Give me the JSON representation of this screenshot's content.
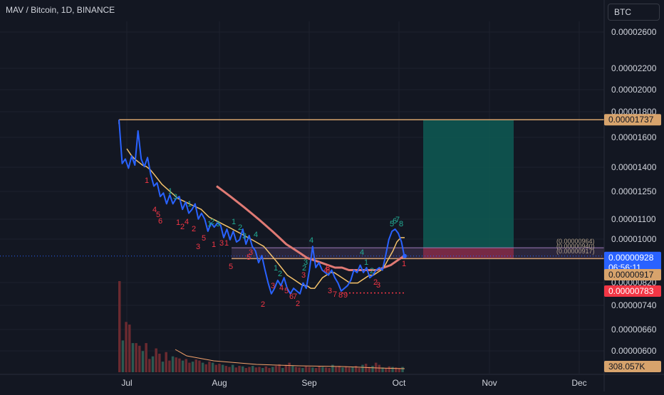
{
  "header": {
    "symbol": "MAV / Bitcoin, 1D, BINANCE",
    "currency": "BTC"
  },
  "chart_data": {
    "type": "line",
    "title": "MAV / Bitcoin, 1D, BINANCE",
    "y_axis": {
      "scale": "log",
      "ylim": [
        6.5e-06,
        2.8e-06
      ],
      "ticks": [
        "0.00002600",
        "0.00002200",
        "0.00002000",
        "0.00001800",
        "0.00001600",
        "0.00001400",
        "0.00001250",
        "0.00001100",
        "0.00001000",
        "0.00000820",
        "0.00000740",
        "0.00000660",
        "0.00000600"
      ]
    },
    "x_axis": {
      "ticks": [
        "Jul",
        "Aug",
        "Sep",
        "Oct",
        "Nov",
        "Dec"
      ]
    },
    "price_labels": [
      {
        "name": "target-level",
        "value": "0.00001737",
        "color": "#d7a36c"
      },
      {
        "name": "current-price",
        "value": "0.00000928",
        "sub": "06:56:11",
        "color": "#2962ff"
      },
      {
        "name": "entry-level",
        "value": "0.00000917",
        "color": "#d7a36c"
      },
      {
        "name": "stop-level",
        "value": "0.00000783",
        "color": "#f23645"
      },
      {
        "name": "volume",
        "value": "308.057K",
        "color": "#d7a36c"
      }
    ],
    "level_annotations": [
      "(0.00000964)",
      "(0.00000940)",
      "(0.00000917)"
    ],
    "position_zone": {
      "entry": 9.17e-06,
      "target": 1.737e-05,
      "stop": 9.64e-06,
      "profit_color": "#0e5a53",
      "loss_color": "#7a1c2e"
    },
    "series": [
      {
        "name": "price",
        "color": "#2962ff",
        "values": [
          1.737e-05,
          1.42e-05,
          1.45e-05,
          1.39e-05,
          1.47e-05,
          1.41e-05,
          1.65e-05,
          1.45e-05,
          1.4e-05,
          1.46e-05,
          1.35e-05,
          1.28e-05,
          1.3e-05,
          1.22e-05,
          1.24e-05,
          1.18e-05,
          1.23e-05,
          1.18e-05,
          1.21e-05,
          1.22e-05,
          1.15e-05,
          1.19e-05,
          1.13e-05,
          1.15e-05,
          1.18e-05,
          1.1e-05,
          1.13e-05,
          1.1e-05,
          1.04e-05,
          1.08e-05,
          1.06e-05,
          1.08e-05,
          1.07e-05,
          1.01e-05,
          1.05e-05,
          1e-05,
          1.04e-05,
          9.9e-06,
          1e-05,
          1.05e-05,
          9.8e-06,
          1.02e-05,
          9.7e-06,
          9.5e-06,
          9e-06,
          9.3e-06,
          8.7e-06,
          8.2e-06,
          7.8e-06,
          8e-06,
          8.3e-06,
          8.1e-06,
          8.4e-06,
          8e-06,
          7.8e-06,
          8e-06,
          7.9e-06,
          7.8e-06,
          8.2e-06,
          8e-06,
          8.7e-06,
          9.7e-06,
          8.8e-06,
          9e-06,
          8.7e-06,
          8.6e-06,
          8.5e-06,
          8.7e-06,
          8.4e-06,
          8.2e-06,
          7.9e-06,
          8e-06,
          8.1e-06,
          8.3e-06,
          8.7e-06,
          8.6e-06,
          8.9e-06,
          8.6e-06,
          8.8e-06,
          8.4e-06,
          8.5e-06,
          8.7e-06,
          8.8e-06,
          8.7e-06,
          9.3e-06,
          1e-05,
          1.04e-05,
          1.05e-05,
          1.03e-05,
          9.9e-06,
          9.2e-06
        ]
      },
      {
        "name": "ma-fast",
        "color": "#f5c26b",
        "values": [
          1.52e-05,
          1.48e-05,
          1.45e-05,
          1.43e-05,
          1.41e-05,
          1.4e-05,
          1.38e-05,
          1.35e-05,
          1.32e-05,
          1.29e-05,
          1.27e-05,
          1.25e-05,
          1.23e-05,
          1.21e-05,
          1.2e-05,
          1.19e-05,
          1.18e-05,
          1.17e-05,
          1.16e-05,
          1.15e-05,
          1.13e-05,
          1.11e-05,
          1.1e-05,
          1.09e-05,
          1.08e-05,
          1.07e-05,
          1.06e-05,
          1.05e-05,
          1.04e-05,
          1.03e-05,
          1.02e-05,
          1.01e-05,
          1e-05,
          9.9e-06,
          9.8e-06,
          9.7e-06,
          9.5e-06,
          9.3e-06,
          9.1e-06,
          8.9e-06,
          8.7e-06,
          8.5e-06,
          8.4e-06,
          8.3e-06,
          8.2e-06,
          8.1e-06,
          8.1e-06,
          8e-06,
          8e-06,
          8.2e-06,
          8.4e-06,
          8.5e-06,
          8.6e-06,
          8.6e-06,
          8.5e-06,
          8.4e-06,
          8.3e-06,
          8.2e-06,
          8.2e-06,
          8.2e-06,
          8.3e-06,
          8.4e-06,
          8.5e-06,
          8.5e-06,
          8.6e-06,
          8.7e-06,
          8.9e-06,
          9.2e-06,
          9.5e-06,
          9.9e-06,
          1.01e-05,
          1.01e-05
        ]
      },
      {
        "name": "ma-slow",
        "color": "#e07a74",
        "values": [
          1.28e-05,
          1.25e-05,
          1.22e-05,
          1.19e-05,
          1.16e-05,
          1.13e-05,
          1.1e-05,
          1.07e-05,
          1.04e-05,
          1.01e-05,
          9.8e-06,
          9.6e-06,
          9.4e-06,
          9.2e-06,
          9.1e-06,
          9e-06,
          8.9e-06,
          8.8e-06,
          8.8e-06,
          8.7e-06,
          8.7e-06,
          8.7e-06,
          8.7e-06,
          8.7e-06,
          8.8e-06,
          8.9e-06,
          9.1e-06,
          9.3e-06
        ]
      }
    ],
    "count_labels_red": [
      "1",
      "4",
      "5",
      "6",
      "1",
      "2",
      "4",
      "2",
      "3",
      "5",
      "1",
      "3",
      "1",
      "5",
      "3",
      "5",
      "2",
      "3",
      "4",
      "5",
      "6",
      "7",
      "2",
      "3",
      "4",
      "5",
      "6",
      "7",
      "8",
      "9",
      "3",
      "2",
      "3",
      "1"
    ],
    "count_labels_green": [
      "1",
      "3",
      "1",
      "1",
      "2",
      "3",
      "1",
      "2",
      "3",
      "4",
      "1",
      "2",
      "4",
      "2",
      "3",
      "4",
      "1",
      "2",
      "5",
      "6",
      "7",
      "8"
    ],
    "volume": {
      "values": [
        172,
        60,
        95,
        90,
        55,
        55,
        50,
        40,
        55,
        25,
        30,
        45,
        35,
        20,
        38,
        22,
        30,
        28,
        26,
        22,
        25,
        18,
        20,
        24,
        22,
        18,
        15,
        20,
        18,
        14,
        16,
        14,
        12,
        10,
        14,
        9,
        12,
        11,
        8,
        10,
        12,
        9,
        10,
        8,
        11,
        8,
        10,
        12,
        15,
        8,
        14,
        18,
        12,
        10,
        9,
        8,
        11,
        10,
        9,
        8,
        12,
        10,
        9,
        8,
        14,
        10,
        12,
        9,
        11,
        9,
        10,
        12,
        8,
        14,
        16,
        10,
        12,
        18,
        14,
        9,
        8,
        11,
        10,
        9,
        8,
        10
      ]
    }
  }
}
